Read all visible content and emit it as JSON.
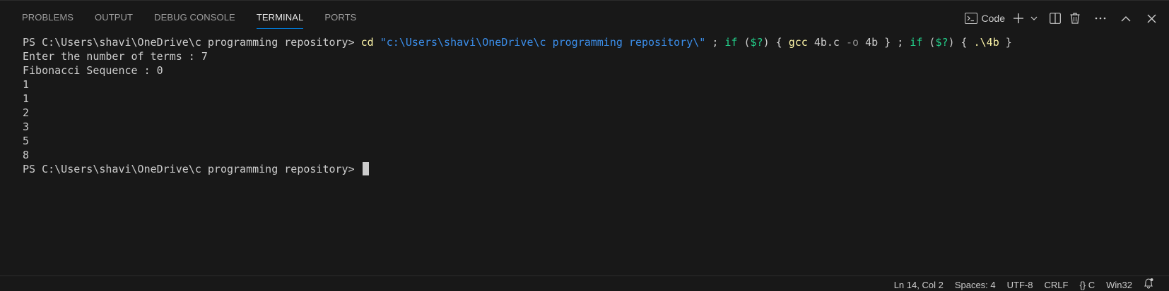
{
  "panel": {
    "tabs": [
      {
        "label": "PROBLEMS"
      },
      {
        "label": "OUTPUT"
      },
      {
        "label": "DEBUG CONSOLE"
      },
      {
        "label": "TERMINAL",
        "active": true
      },
      {
        "label": "PORTS"
      }
    ],
    "actions": {
      "launch_profile_label": "Code",
      "icons": [
        "terminal-icon",
        "add-icon",
        "chevron-down-icon",
        "split-icon",
        "trash-icon",
        "more-icon",
        "chevron-up-icon",
        "close-icon"
      ]
    }
  },
  "terminal": {
    "prompt": "PS C:\\Users\\shavi\\OneDrive\\c programming repository> ",
    "command": {
      "cd": "cd",
      "path": "\"c:\\Users\\shavi\\OneDrive\\c programming repository\\\"",
      "part1": " ; ",
      "if1": "if",
      "cond1_open": " (",
      "var1": "$?",
      "cond1_close": ") { ",
      "gcc": "gcc",
      "gcc_args1": " 4b.c ",
      "flag": "-o",
      "gcc_args2": " 4b } ; ",
      "if2": "if",
      "cond2_open": " (",
      "var2": "$?",
      "cond2_close": ") { ",
      "run": ".\\4b",
      "end": " }"
    },
    "output": [
      "Enter the number of terms : 7",
      "Fibonacci Sequence : 0",
      "1",
      "1",
      "2",
      "3",
      "5",
      "8"
    ],
    "final_prompt": "PS C:\\Users\\shavi\\OneDrive\\c programming repository> "
  },
  "status_bar": {
    "position": "Ln 14, Col 2",
    "indent": "Spaces: 4",
    "encoding": "UTF-8",
    "eol": "CRLF",
    "language_braces": "{}",
    "language": "C",
    "platform": "Win32"
  },
  "colors": {
    "background": "#181818",
    "accent": "#0078d4",
    "command": "#f9f1a5",
    "string": "#3b8eea",
    "keyword": "#23d18b"
  }
}
